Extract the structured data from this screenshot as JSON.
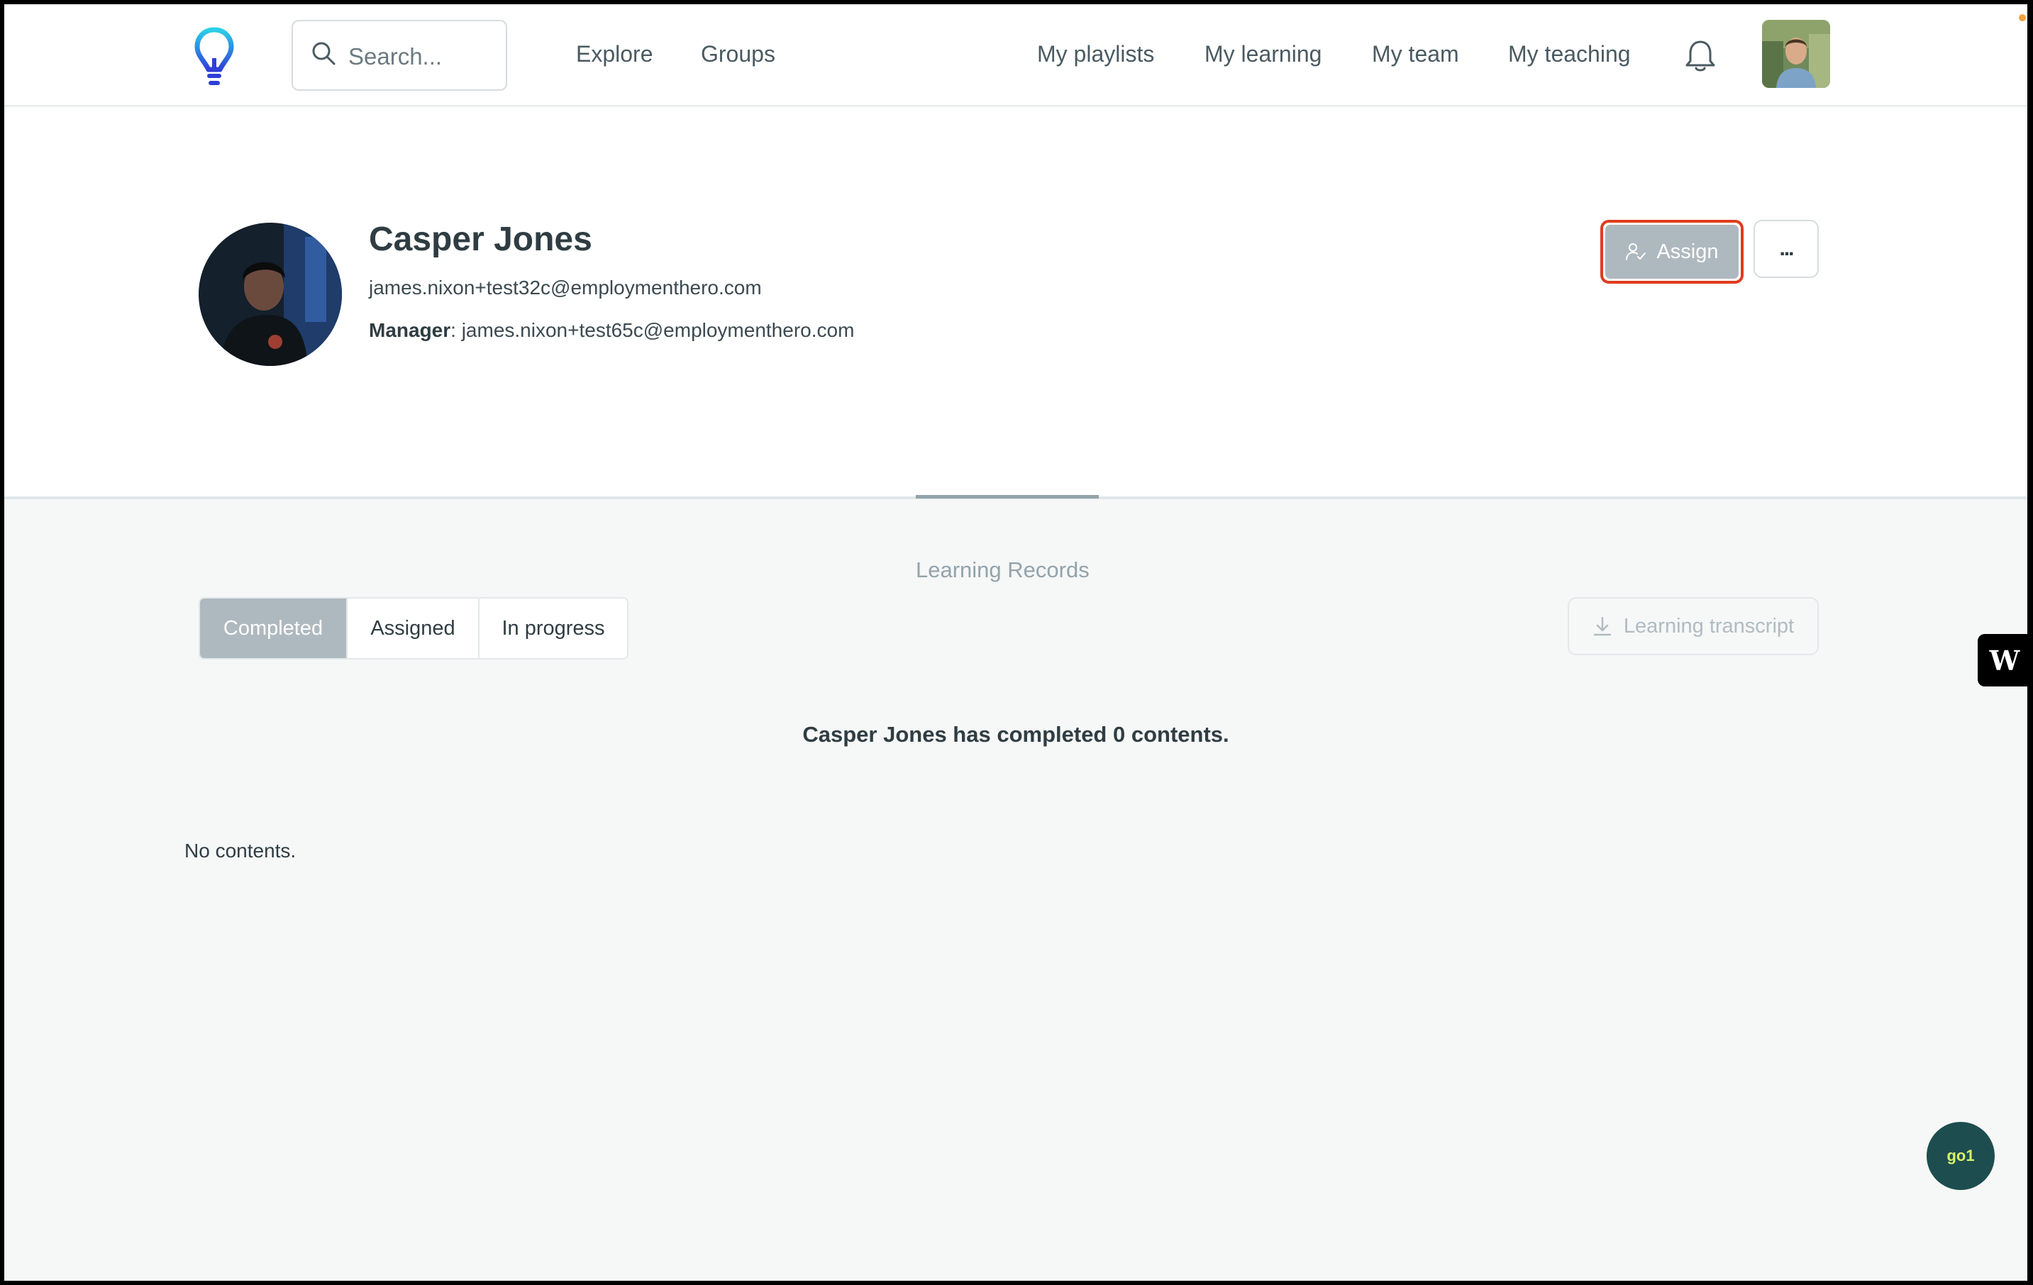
{
  "nav": {
    "search_placeholder": "Search...",
    "links_left": [
      "Explore",
      "Groups"
    ],
    "links_right": [
      "My playlists",
      "My learning",
      "My team",
      "My teaching"
    ]
  },
  "profile": {
    "name": "Casper Jones",
    "email": "james.nixon+test32c@employmenthero.com",
    "manager_label": "Manager",
    "manager_email": ": james.nixon+test65c@employmenthero.com",
    "assign_label": "Assign",
    "more_label": "..."
  },
  "tabs": {
    "learning_records": "Learning Records"
  },
  "filters": {
    "options": [
      "Completed",
      "Assigned",
      "In progress"
    ],
    "selected": "Completed"
  },
  "transcript_label": "Learning transcript",
  "completed_message": "Casper Jones has completed 0 contents.",
  "empty_message": "No contents.",
  "widgets": {
    "side_widget_label": "W",
    "chat_label": "go1"
  },
  "colors": {
    "accent_highlight": "#e03b1f",
    "button_grey": "#aeb9bf",
    "chat_bubble": "#1d4d4f"
  }
}
